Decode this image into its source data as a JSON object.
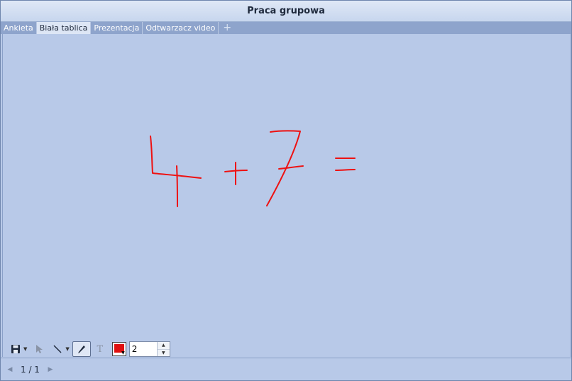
{
  "window": {
    "title": "Praca grupowa"
  },
  "tabs": [
    {
      "label": "Ankieta",
      "active": false
    },
    {
      "label": "Biała tablica",
      "active": true
    },
    {
      "label": "Prezentacja",
      "active": false
    },
    {
      "label": "Odtwarzacz video",
      "active": false
    }
  ],
  "tab_add_glyph": "+",
  "toolbar": {
    "text_tool_glyph": "T",
    "pen_color": "#e01010",
    "stroke_width": "2"
  },
  "pagination": {
    "indicator": "1 / 1"
  },
  "colors": {
    "ink": "#ee1111",
    "canvas": "#b8c9e8",
    "active_tab": "#dde6f5"
  }
}
